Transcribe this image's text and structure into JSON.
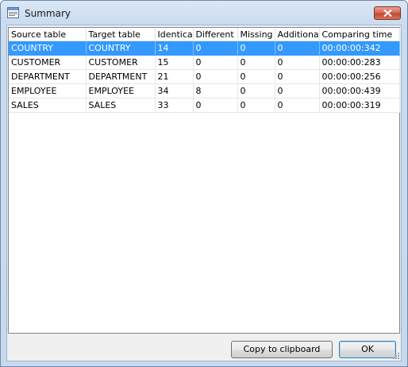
{
  "window": {
    "title": "Summary"
  },
  "columns": [
    "Source table",
    "Target table",
    "Identical",
    "Different",
    "Missing",
    "Additional",
    "Comparing time"
  ],
  "rows": [
    [
      "COUNTRY",
      "COUNTRY",
      "14",
      "0",
      "0",
      "0",
      "00:00:00:342"
    ],
    [
      "CUSTOMER",
      "CUSTOMER",
      "15",
      "0",
      "0",
      "0",
      "00:00:00:283"
    ],
    [
      "DEPARTMENT",
      "DEPARTMENT",
      "21",
      "0",
      "0",
      "0",
      "00:00:00:256"
    ],
    [
      "EMPLOYEE",
      "EMPLOYEE",
      "34",
      "8",
      "0",
      "0",
      "00:00:00:439"
    ],
    [
      "SALES",
      "SALES",
      "33",
      "0",
      "0",
      "0",
      "00:00:00:319"
    ]
  ],
  "selected_row": 0,
  "buttons": {
    "copy": "Copy to clipboard",
    "ok": "OK"
  },
  "colors": {
    "selection": "#3399ff",
    "close_button": "#c14a33"
  },
  "icons": {
    "title": "summary-window-icon",
    "close": "close-icon",
    "grip": "resize-grip-icon"
  }
}
